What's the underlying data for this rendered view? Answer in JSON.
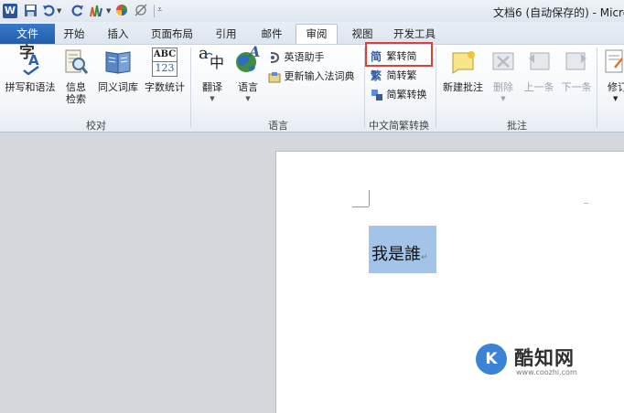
{
  "title_bar": {
    "title": "文档6 (自动保存的) - Micro"
  },
  "tabs": {
    "file": "文件",
    "items": [
      "开始",
      "插入",
      "页面布局",
      "引用",
      "邮件",
      "审阅",
      "视图",
      "开发工具"
    ],
    "active": "审阅"
  },
  "ribbon": {
    "proofing": {
      "group_label": "校对",
      "spelling": "拼写和语法",
      "research_line1": "信息",
      "research_line2": "检索",
      "thesaurus": "同义词库",
      "word_count": "字数统计",
      "abc_text": "ABC",
      "num_text": "123"
    },
    "language": {
      "group_label": "语言",
      "translate": "翻译",
      "language": "语言",
      "english_assistant": "英语助手",
      "update_ime": "更新输入法词典"
    },
    "chinese_conversion": {
      "group_label": "中文简繁转换",
      "to_simplified": "繁转简",
      "to_traditional": "简转繁",
      "convert": "简繁转换",
      "icon_simplified_char": "简",
      "icon_traditional_char": "繁"
    },
    "comments": {
      "group_label": "批注",
      "new_comment": "新建批注",
      "delete": "删除",
      "previous": "上一条",
      "next": "下一条"
    },
    "tracking": {
      "track_changes": "修订"
    }
  },
  "document": {
    "text": "我是誰"
  },
  "watermark": {
    "brand": "酷知网",
    "url": "www.coozhi.com"
  }
}
